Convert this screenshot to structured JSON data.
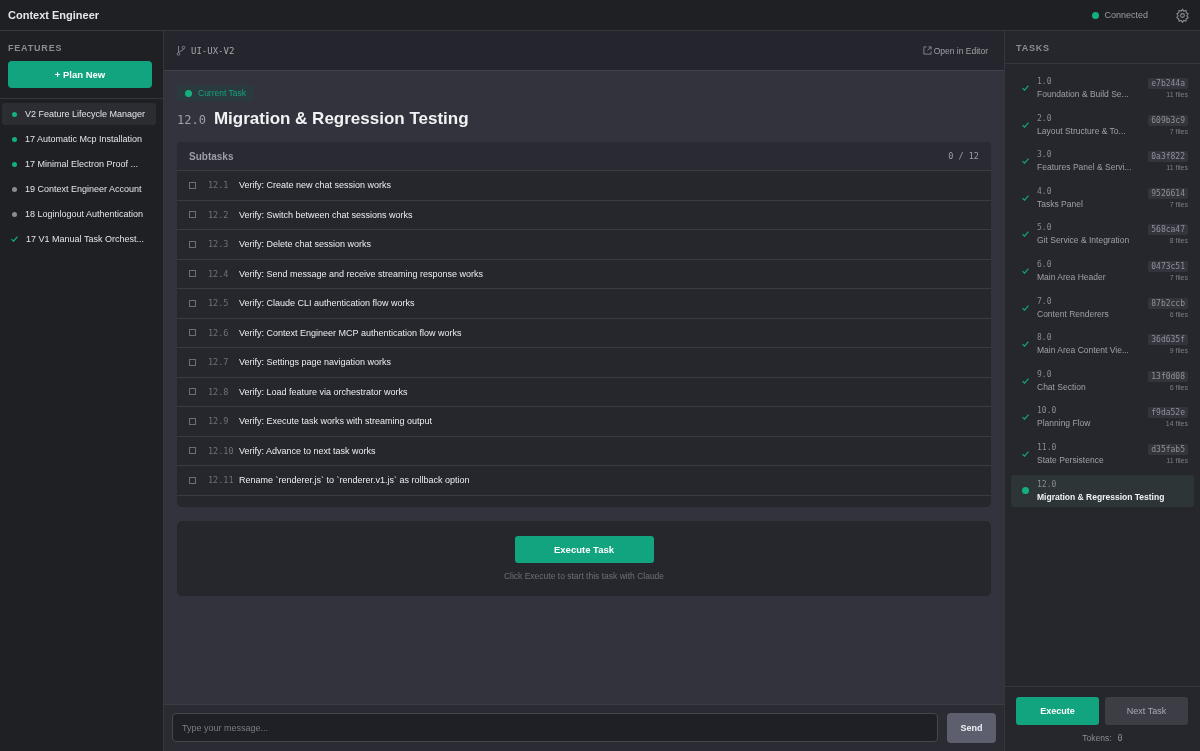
{
  "app": {
    "title": "Context Engineer",
    "connection": {
      "label": "Connected",
      "connected": true
    }
  },
  "features": {
    "heading": "FEATURES",
    "plan_button": "+ Plan New",
    "items": [
      {
        "label": "V2 Feature Lifecycle Manager",
        "kind": "active",
        "selected": true
      },
      {
        "label": "17 Automatic Mcp Installation",
        "kind": "active",
        "selected": false
      },
      {
        "label": "17 Minimal Electron Proof ...",
        "kind": "active",
        "selected": false
      },
      {
        "label": "19 Context Engineer Account",
        "kind": "pending",
        "selected": false
      },
      {
        "label": "18 Loginlogout Authentication",
        "kind": "pending",
        "selected": false
      },
      {
        "label": "17 V1 Manual Task Orchest...",
        "kind": "done",
        "selected": false
      }
    ]
  },
  "main": {
    "branch": "UI-UX-V2",
    "open_editor": "Open in Editor",
    "badge": "Current Task",
    "task_number": "12.0",
    "task_title": "Migration & Regression Testing",
    "subtasks": {
      "heading": "Subtasks",
      "count": "0 / 12",
      "items": [
        {
          "number": "12.1",
          "label": "Verify: Create new chat session works",
          "checked": false
        },
        {
          "number": "12.2",
          "label": "Verify: Switch between chat sessions works",
          "checked": false
        },
        {
          "number": "12.3",
          "label": "Verify: Delete chat session works",
          "checked": false
        },
        {
          "number": "12.4",
          "label": "Verify: Send message and receive streaming response works",
          "checked": false
        },
        {
          "number": "12.5",
          "label": "Verify: Claude CLI authentication flow works",
          "checked": false
        },
        {
          "number": "12.6",
          "label": "Verify: Context Engineer MCP authentication flow works",
          "checked": false
        },
        {
          "number": "12.7",
          "label": "Verify: Settings page navigation works",
          "checked": false
        },
        {
          "number": "12.8",
          "label": "Verify: Load feature via orchestrator works",
          "checked": false
        },
        {
          "number": "12.9",
          "label": "Verify: Execute task works with streaming output",
          "checked": false
        },
        {
          "number": "12.10",
          "label": "Verify: Advance to next task works",
          "checked": false
        },
        {
          "number": "12.11",
          "label": "Rename `renderer.js` to `renderer.v1.js` as rollback option",
          "checked": false
        }
      ]
    },
    "execute_button": "Execute Task",
    "hint": "Click Execute to start this task with Claude",
    "chat": {
      "placeholder": "Type your message...",
      "send": "Send"
    }
  },
  "tasks": {
    "heading": "TASKS",
    "items": [
      {
        "number": "1.0",
        "title": "Foundation & Build Se...",
        "commit": "e7b244a",
        "files": "11 files",
        "done": true,
        "selected": false
      },
      {
        "number": "2.0",
        "title": "Layout Structure & To...",
        "commit": "609b3c9",
        "files": "7 files",
        "done": true,
        "selected": false
      },
      {
        "number": "3.0",
        "title": "Features Panel & Servi...",
        "commit": "0a3f822",
        "files": "11 files",
        "done": true,
        "selected": false
      },
      {
        "number": "4.0",
        "title": "Tasks Panel",
        "commit": "9526614",
        "files": "7 files",
        "done": true,
        "selected": false
      },
      {
        "number": "5.0",
        "title": "Git Service & Integration",
        "commit": "568ca47",
        "files": "8 files",
        "done": true,
        "selected": false
      },
      {
        "number": "6.0",
        "title": "Main Area Header",
        "commit": "0473c51",
        "files": "7 files",
        "done": true,
        "selected": false
      },
      {
        "number": "7.0",
        "title": "Content Renderers",
        "commit": "87b2ccb",
        "files": "6 files",
        "done": true,
        "selected": false
      },
      {
        "number": "8.0",
        "title": "Main Area Content Vie...",
        "commit": "36d635f",
        "files": "9 files",
        "done": true,
        "selected": false
      },
      {
        "number": "9.0",
        "title": "Chat Section",
        "commit": "13f0d08",
        "files": "6 files",
        "done": true,
        "selected": false
      },
      {
        "number": "10.0",
        "title": "Planning Flow",
        "commit": "f9da52e",
        "files": "14 files",
        "done": true,
        "selected": false
      },
      {
        "number": "11.0",
        "title": "State Persistence",
        "commit": "d35fab5",
        "files": "11 files",
        "done": true,
        "selected": false
      },
      {
        "number": "12.0",
        "title": "Migration & Regression Testing",
        "done": false,
        "selected": true
      }
    ],
    "execute": "Execute",
    "next": "Next Task",
    "tokens_label": "Tokens:",
    "tokens_value": "0"
  }
}
